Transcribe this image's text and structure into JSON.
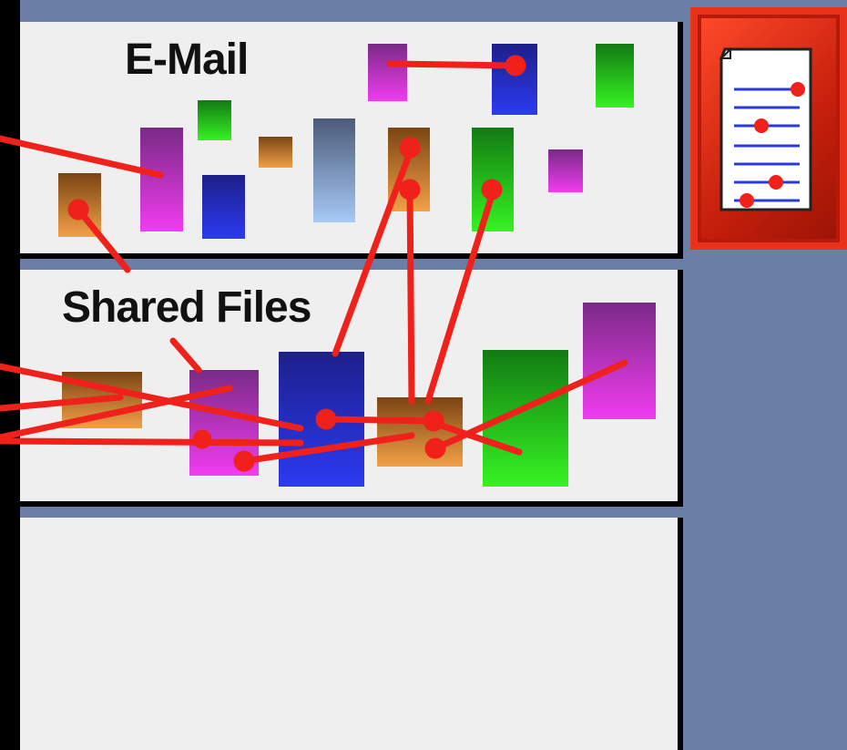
{
  "panels": {
    "email": {
      "label": "E-Mail"
    },
    "shared": {
      "label": "Shared Files"
    },
    "empty": {
      "label": ""
    }
  },
  "side_button": {
    "icon": "document-settings-icon",
    "accent": "#d32a14"
  },
  "colors": {
    "panel_bg": "#efefef",
    "desktop_bg": "#6b7fa6",
    "link": "#f0201a",
    "purple": "#d03ee0",
    "blue": "#2532d8",
    "green": "#2fd826",
    "brown": "#c77a36",
    "steel": "#8aaedc"
  }
}
